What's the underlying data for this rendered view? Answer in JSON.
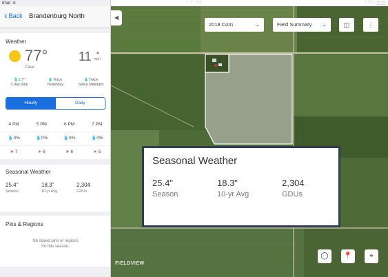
{
  "status_bar": {
    "device": "iPad",
    "time": "3:47 PM",
    "battery": "100%"
  },
  "nav": {
    "back_label": "Back",
    "title": "Brandenburg North"
  },
  "weather": {
    "heading": "Weather",
    "temperature": "77°",
    "condition": "Clear",
    "wind_speed": "11",
    "wind_unit": "mph",
    "precip": [
      {
        "value": "1.7\"",
        "label": "3 day total"
      },
      {
        "value": "Trace",
        "label": "Yesterday"
      },
      {
        "value": "Trace",
        "label": "Since Midnight"
      }
    ],
    "tabs": {
      "hourly": "Hourly",
      "daily": "Daily"
    },
    "hours": [
      "4 PM",
      "5 PM",
      "6 PM",
      "7 PM"
    ],
    "precip_chance": [
      "0%",
      "0%",
      "0%",
      "0%"
    ],
    "wind": [
      "7",
      "6",
      "6",
      "5"
    ]
  },
  "seasonal": {
    "heading": "Seasonal Weather",
    "items": [
      {
        "value": "25.4\"",
        "label": "Season"
      },
      {
        "value": "18.3\"",
        "label": "10-yr Avg"
      },
      {
        "value": "2,304",
        "label": "GDUs"
      }
    ]
  },
  "pins": {
    "heading": "Pins & Regions",
    "empty_line1": "No saved pins or regions",
    "empty_line2": "for this season."
  },
  "map": {
    "season_select": "2018 Corn",
    "view_select": "Field Summary",
    "logo": "FIELDVIEW",
    "callout": {
      "title": "Seasonal Weather",
      "items": [
        {
          "value": "25.4\"",
          "label": "Season"
        },
        {
          "value": "18.3\"",
          "label": "10-yr Avg"
        },
        {
          "value": "2,304",
          "label": "GDUs"
        }
      ]
    }
  },
  "colors": {
    "accent": "#1a6fe0",
    "wind_arrow": "#d9534f",
    "sun": "#f5c518",
    "callout_border": "#2d3e50"
  },
  "icons": [
    "wifi-icon",
    "battery-icon",
    "back-chevron-icon",
    "sun-icon",
    "wind-arrow-icon",
    "drop-icon",
    "collapse-icon",
    "chevron-down-icon",
    "layout-icon",
    "more-icon",
    "lasso-icon",
    "pin-icon",
    "locate-icon"
  ]
}
